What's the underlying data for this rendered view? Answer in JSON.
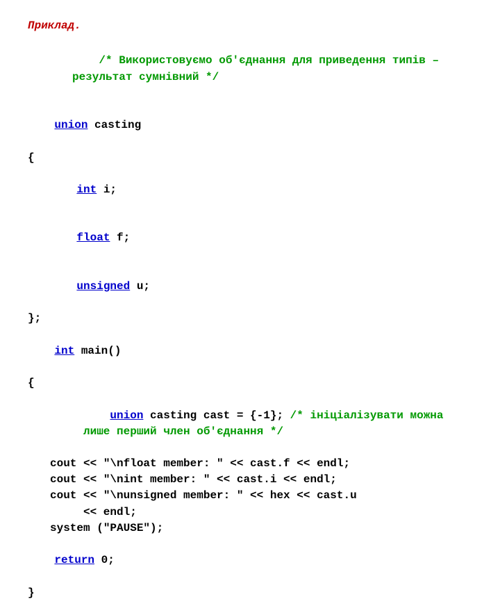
{
  "heading": "Приклад.",
  "code": {
    "comment1a": "/* Використовуємо об'єднання для приведення типів – результат сумнівний */",
    "kw_union": "union",
    "casting": " casting",
    "lbrace": "{",
    "kw_int": "int",
    "mem_i": " i;",
    "kw_float": "float",
    "mem_f": " f;",
    "kw_unsigned": "unsigned",
    "mem_u": " u;",
    "rbrace_semi": "};",
    "main_decl": " main()",
    "lbrace2": "{",
    "cast_decl": " casting cast = {-1}; ",
    "comment2": "/* ініціалізувати можна лише перший член об'єднання */",
    "cout1": "cout << \"\\nfloat member: \" << cast.f << endl;",
    "cout2": "cout << \"\\nint member: \" << cast.i << endl;",
    "cout3a": "cout << \"\\nunsigned member: \" << hex << cast.u ",
    "cout3b": "<< endl;",
    "syspause": "system (\"PAUSE\");",
    "kw_return": "return",
    "ret0": " 0;",
    "rbrace2": "}"
  }
}
